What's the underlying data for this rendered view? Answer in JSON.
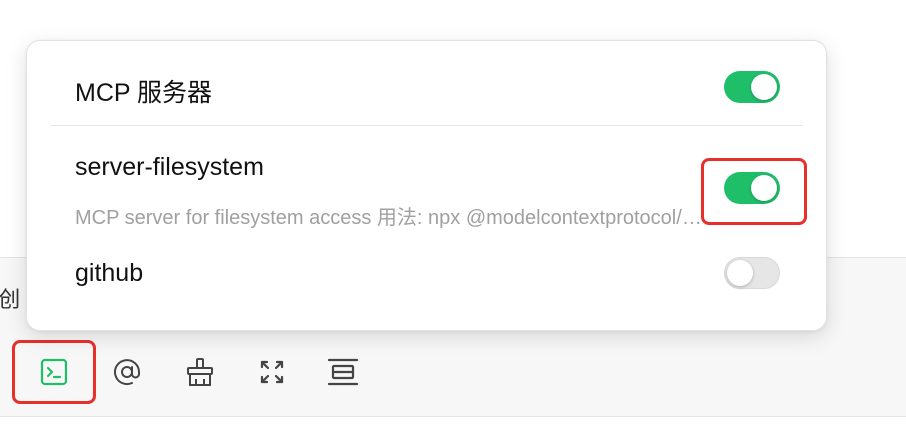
{
  "composer": {
    "partial_text": "创"
  },
  "popup": {
    "title": "MCP 服务器",
    "master_toggle_on": true,
    "servers": [
      {
        "name": "server-filesystem",
        "description": "MCP server for filesystem access 用法: npx @modelcontextprotocol/server-filesystem",
        "enabled": true
      },
      {
        "name": "github",
        "description": "",
        "enabled": false
      }
    ]
  },
  "toolbar": {
    "icons": [
      "terminal-icon",
      "at-mention-icon",
      "clear-brush-icon",
      "expand-icon",
      "collapse-lines-icon"
    ]
  },
  "colors": {
    "toggle_on": "#1fbf6a",
    "highlight": "#e8302a",
    "mcp_icon": "#1fbf6a"
  }
}
